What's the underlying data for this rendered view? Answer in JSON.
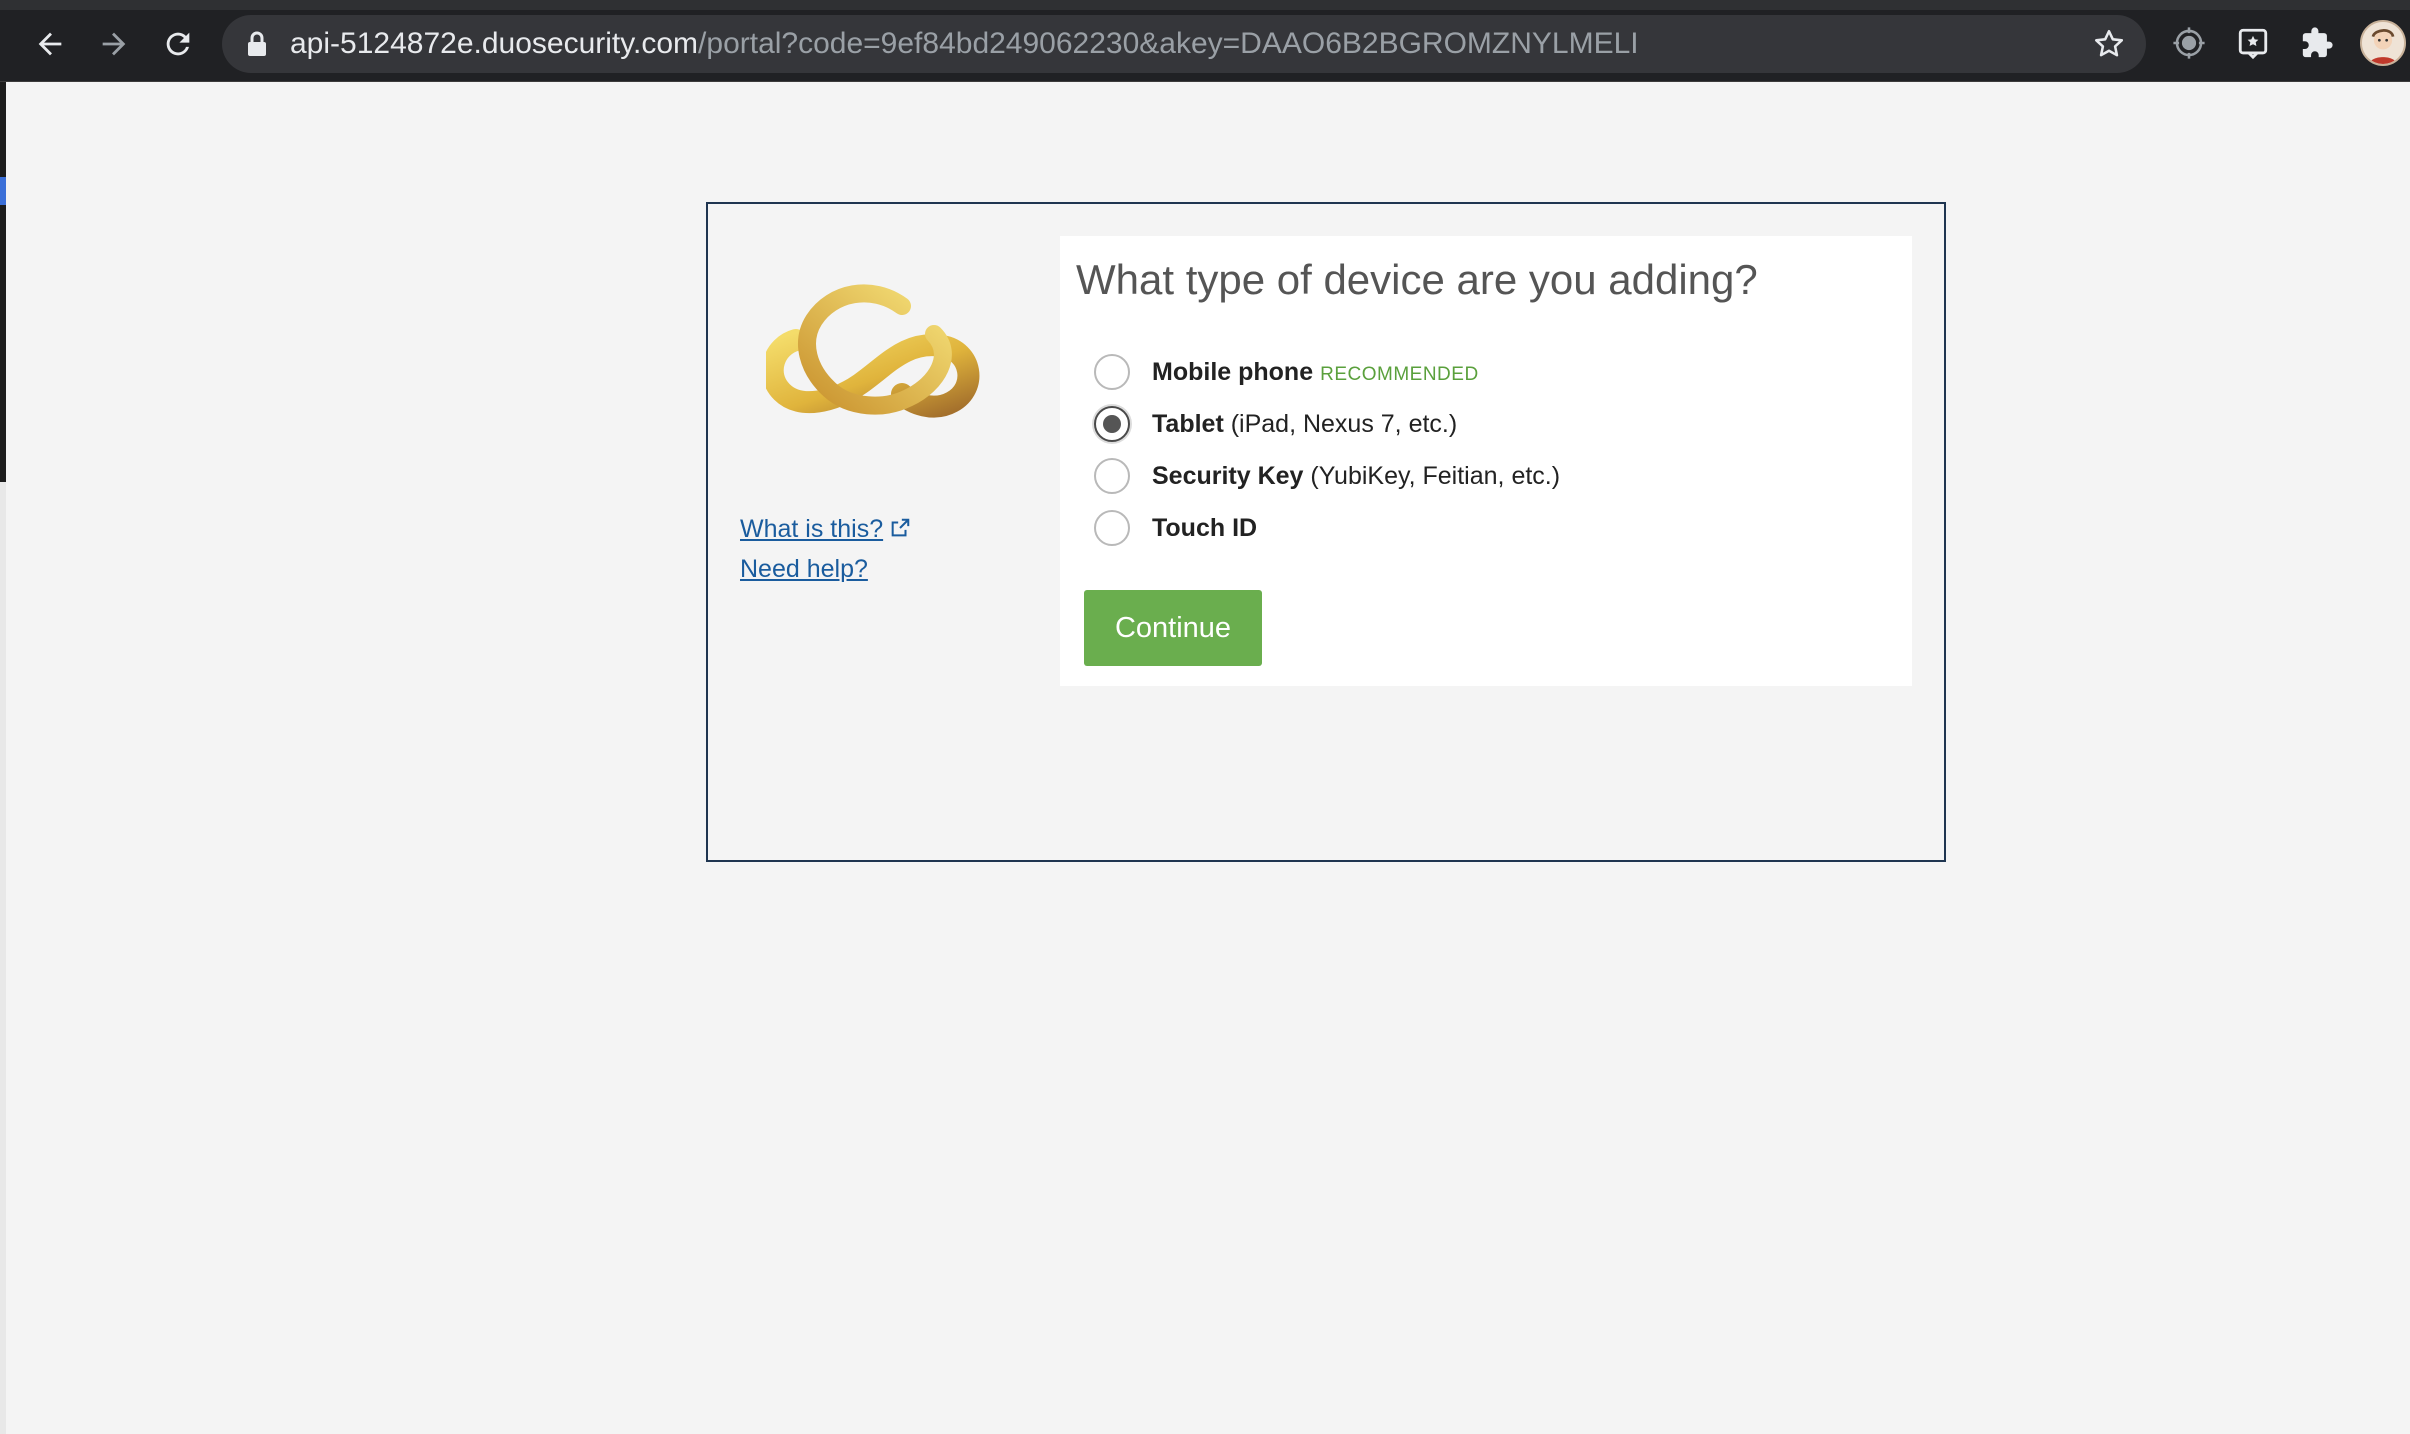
{
  "browser": {
    "url_host": "api-5124872e.duosecurity.com",
    "url_path": "/portal?code=9ef84bd249062230&akey=DAAO6B2BGROMZNYLMELI"
  },
  "sidebar": {
    "what_is_this": "What is this?",
    "need_help": "Need help?"
  },
  "prompt": {
    "question": "What type of device are you adding?",
    "options": [
      {
        "name": "Mobile phone",
        "note": "",
        "badge": "RECOMMENDED",
        "checked": false
      },
      {
        "name": "Tablet",
        "note": " (iPad, Nexus 7, etc.)",
        "badge": "",
        "checked": true
      },
      {
        "name": "Security Key",
        "note": " (YubiKey, Feitian, etc.)",
        "badge": "",
        "checked": false
      },
      {
        "name": "Touch ID",
        "note": "",
        "badge": "",
        "checked": false
      }
    ],
    "continue_label": "Continue"
  },
  "colors": {
    "accent_green": "#6aae4e",
    "link_blue": "#1a5c9e",
    "frame_border": "#1f3550"
  },
  "icons": [
    "back-arrow-icon",
    "forward-arrow-icon",
    "reload-icon",
    "lock-icon",
    "star-icon",
    "extension-icon",
    "puzzle-icon",
    "external-link-icon"
  ]
}
